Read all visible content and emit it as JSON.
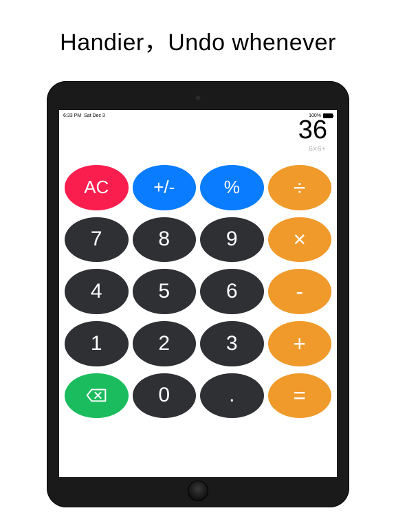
{
  "headline": "Handier，Undo whenever",
  "statusbar": {
    "time": "6:33 PM",
    "date": "Sat Dec 3",
    "battery_pct": "100%"
  },
  "display": {
    "result": "36",
    "history": "6×6+"
  },
  "keys": {
    "ac": "AC",
    "sign": "+/-",
    "percent": "%",
    "divide": "÷",
    "n7": "7",
    "n8": "8",
    "n9": "9",
    "multiply": "×",
    "n4": "4",
    "n5": "5",
    "n6": "6",
    "minus": "-",
    "n1": "1",
    "n2": "2",
    "n3": "3",
    "plus": "+",
    "n0": "0",
    "dot": ".",
    "equals": "="
  },
  "colors": {
    "red": "#fa1e4e",
    "blue": "#0a7cff",
    "orange": "#ef9a2a",
    "dark": "#2e3034",
    "green": "#1bbc5e"
  }
}
